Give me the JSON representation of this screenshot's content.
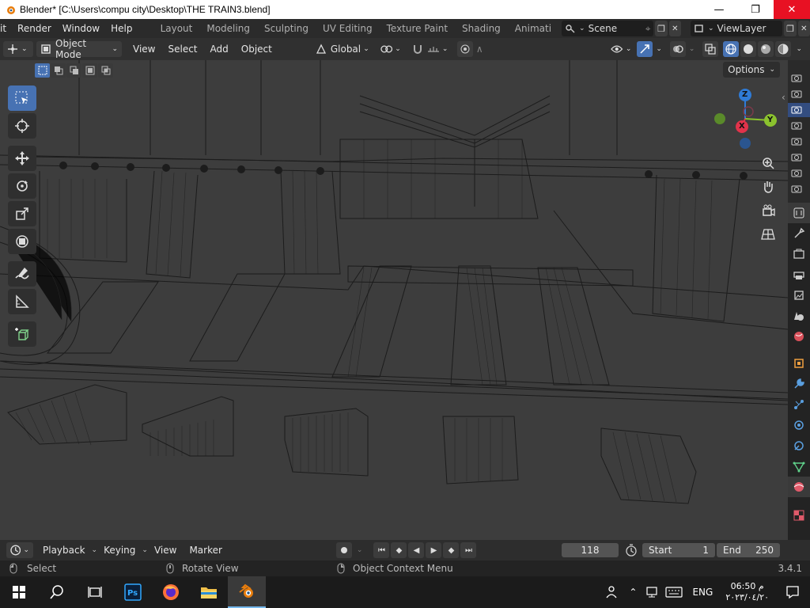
{
  "titlebar": {
    "title": "Blender* [C:\\Users\\compu city\\Desktop\\THE TRAIN3.blend]",
    "minimize": "—",
    "maximize": "❐",
    "close": "✕"
  },
  "topbar": {
    "menus": [
      "it",
      "Render",
      "Window",
      "Help"
    ],
    "workspaces": [
      "Layout",
      "Modeling",
      "Sculpting",
      "UV Editing",
      "Texture Paint",
      "Shading",
      "Animati"
    ],
    "scene": "Scene",
    "view_layer": "ViewLayer"
  },
  "header": {
    "mode": "Object Mode",
    "menus": [
      "View",
      "Select",
      "Add",
      "Object"
    ],
    "orientation": "Global"
  },
  "viewport": {
    "options": "Options",
    "gizmo": {
      "z": "Z",
      "y": "Y",
      "x": "X"
    }
  },
  "timeline": {
    "menus": [
      "Playback",
      "Keying",
      "View",
      "Marker"
    ],
    "current_frame": "118",
    "start_label": "Start",
    "start_value": "1",
    "end_label": "End",
    "end_value": "250"
  },
  "statusbar": {
    "left": "Select",
    "middle": "Rotate View",
    "right": "Object Context Menu",
    "version": "3.4.1"
  },
  "taskbar": {
    "lang": "ENG",
    "time": "06:50 م",
    "date": "٢٠٢٣/٠٤/٢٠"
  },
  "colors": {
    "accent": "#4772b3",
    "axis_x": "#e2334b",
    "axis_y": "#8bc22e",
    "axis_z": "#2f7bd6",
    "close_red": "#e81123"
  }
}
